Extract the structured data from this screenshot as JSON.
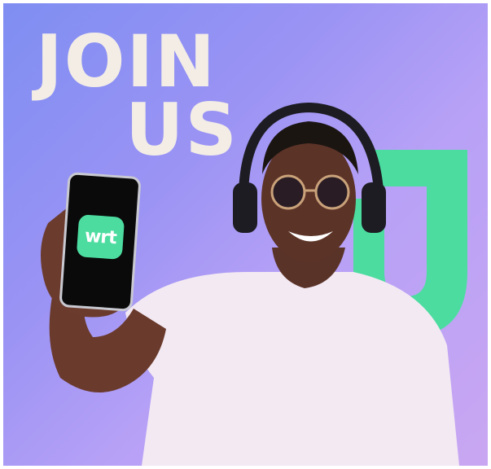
{
  "headline": {
    "line1": "JOIN",
    "line2": "US"
  },
  "app_icon": {
    "label": "wrt",
    "color": "#4cdca0"
  },
  "colors": {
    "accent_green": "#4cdca0",
    "headline": "#f3ede6",
    "background_start": "#7f8ef2",
    "background_end": "#c9a6f2"
  }
}
